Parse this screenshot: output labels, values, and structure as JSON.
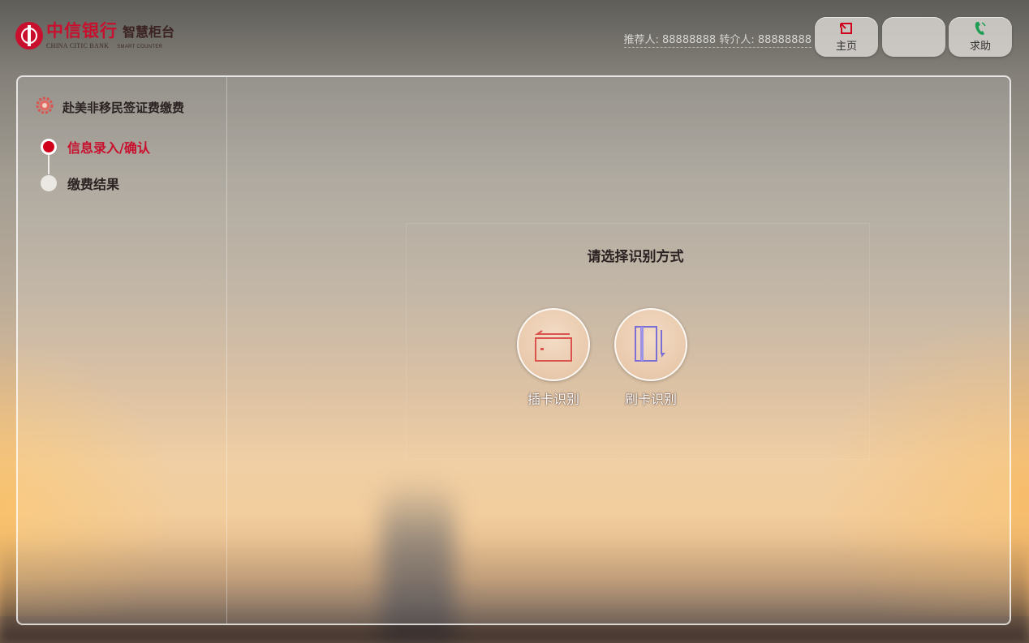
{
  "brand": {
    "name_cn": "中信银行",
    "product_cn": "智慧柜台",
    "name_en": "CHINA CITIC BANK",
    "product_en": "SMART COUNTER",
    "color": "#c8102e"
  },
  "header": {
    "referrer_text": "推荐人: 88888888 转介人: 88888888",
    "buttons": {
      "home": {
        "label": "主页",
        "icon": "home-return-icon"
      },
      "blank": {
        "label": "",
        "icon": ""
      },
      "help": {
        "label": "求助",
        "icon": "phone-icon"
      }
    }
  },
  "sidebar": {
    "service_title": "赴美非移民签证费缴费",
    "service_icon": "gear-icon",
    "steps": [
      {
        "label": "信息录入/确认",
        "state": "active"
      },
      {
        "label": "缴费结果",
        "state": "pending"
      }
    ]
  },
  "main": {
    "prompt": "请选择识别方式",
    "options": [
      {
        "label": "插卡识别",
        "icon": "card-insert-icon",
        "color": "#d9534f"
      },
      {
        "label": "刷卡识别",
        "icon": "card-swipe-icon",
        "color": "#7b6fd6"
      }
    ]
  },
  "colors": {
    "accent_red": "#d0021b",
    "panel_border": "#ffffff"
  }
}
